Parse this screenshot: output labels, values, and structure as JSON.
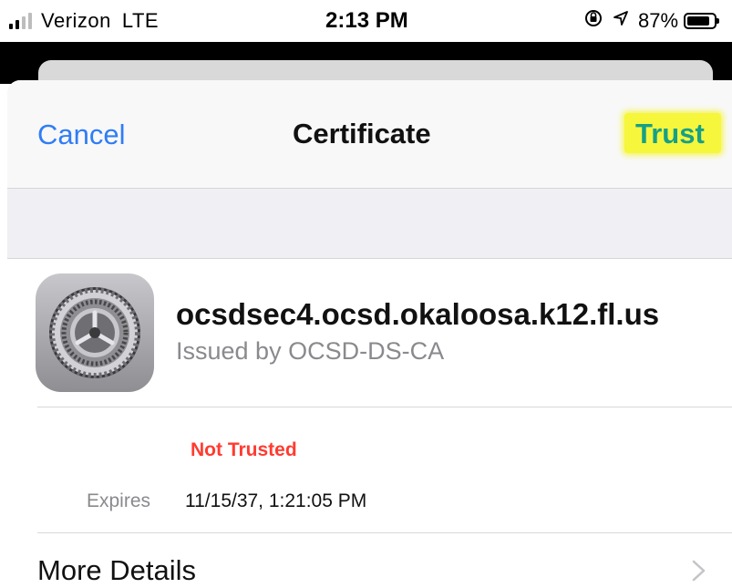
{
  "status_bar": {
    "carrier": "Verizon",
    "network": "LTE",
    "time": "2:13 PM",
    "battery": "87%",
    "battery_level": 0.87,
    "signal_bars": 2,
    "icons": [
      "signal-icon",
      "orientation-lock-icon",
      "location-icon",
      "battery-icon"
    ]
  },
  "nav": {
    "cancel_label": "Cancel",
    "title": "Certificate",
    "trust_label": "Trust",
    "highlight_color": "#f6f63d"
  },
  "certificate": {
    "icon": "settings-gear-icon",
    "host": "ocsdsec4.ocsd.okaloosa.k12.fl.us",
    "issuer": "Issued by OCSD-DS-CA",
    "status": "Not Trusted",
    "expires_label": "Expires",
    "expires_value": "11/15/37, 1:21:05 PM"
  },
  "more_details": {
    "label": "More Details",
    "icon": "chevron-right-icon"
  },
  "colors": {
    "accent_blue": "#2f7df6",
    "trust_text": "#16a086",
    "not_trusted_red": "#ff3b30"
  }
}
